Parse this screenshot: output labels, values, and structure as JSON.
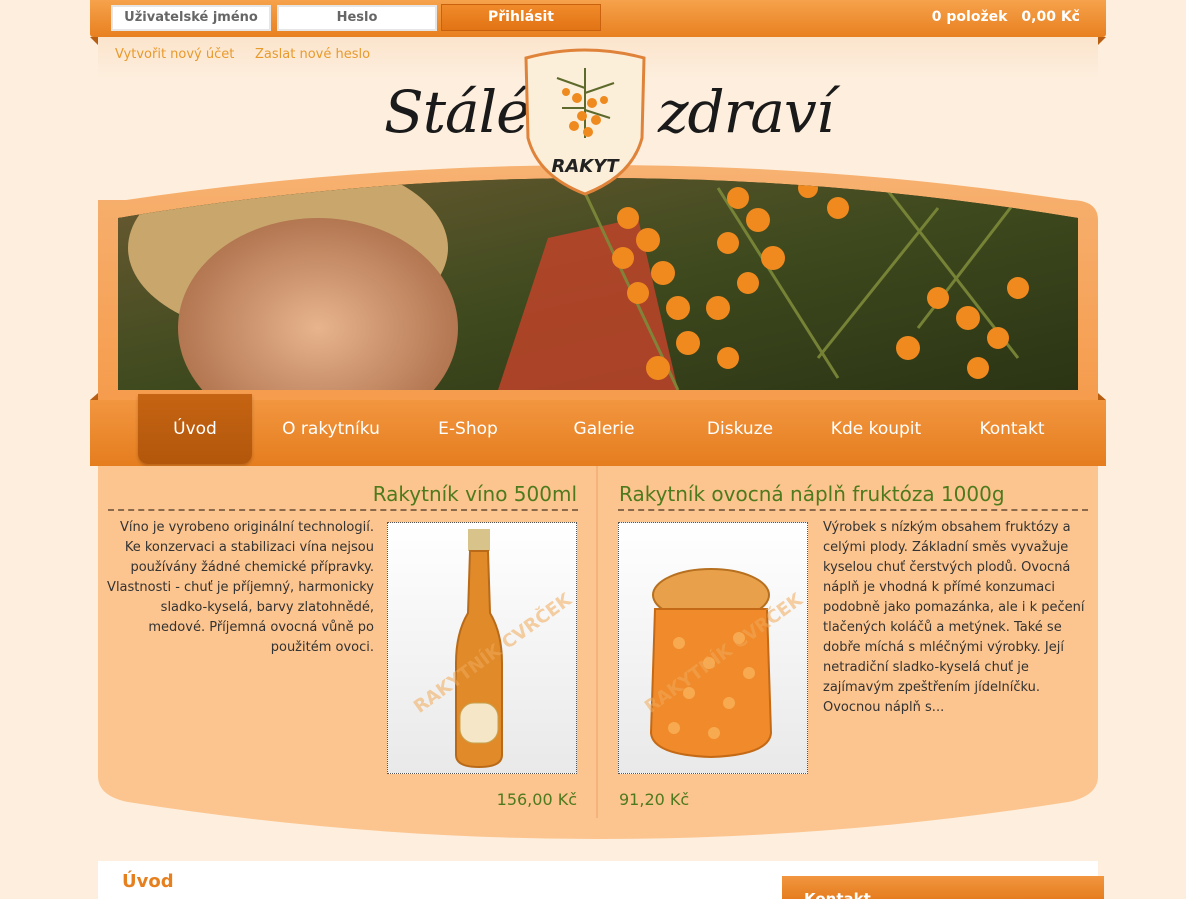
{
  "login": {
    "username_placeholder": "Uživatelské jméno",
    "password_placeholder": "Heslo",
    "submit_label": "Přihlásit"
  },
  "cart": {
    "items": "0 položek",
    "total": "0,00 Kč"
  },
  "account": {
    "create_label": "Vytvořit nový účet",
    "reset_label": "Zaslat nové heslo"
  },
  "logo": {
    "left": "Stálé",
    "right": "zdraví",
    "badge": "RAKYT"
  },
  "nav": {
    "items": [
      {
        "label": "Úvod",
        "active": true
      },
      {
        "label": "O rakytníku"
      },
      {
        "label": "E-Shop"
      },
      {
        "label": "Galerie"
      },
      {
        "label": "Diskuze"
      },
      {
        "label": "Kde koupit"
      },
      {
        "label": "Kontakt"
      }
    ]
  },
  "products": [
    {
      "title": "Rakytník víno 500ml",
      "description": "Víno je vyrobeno originální technologií. Ke konzervaci a stabilizaci vína nejsou používány žádné chemické přípravky. Vlastnosti - chuť je příjemný, harmonicky sladko-kyselá, barvy zlatohnědé, medové. Příjemná ovocná vůně po použitém ovoci.",
      "price": "156,00 Kč",
      "watermark": "RAKYTNÍK CVRČEK"
    },
    {
      "title": "Rakytník ovocná náplň fruktóza 1000g",
      "description": "Výrobek s nízkým obsahem fruktózy a celými plody. Základní směs vyvažuje kyselou chuť čerstvých plodů. Ovocná náplň je vhodná k přímé konzumaci podobně jako pomazánka, ale i k pečení tlačených koláčů a metýnek. Také se dobře míchá s mléčnými výrobky. Její netradiční sladko-kyselá chuť je zajímavým zpeštřením jídelníčku. Ovocnou náplň s...",
      "price": "91,20 Kč",
      "watermark": "RAKYTNÍK CVRČEK"
    }
  ],
  "content": {
    "section_title": "Úvod"
  },
  "sidebar": {
    "box_title": "Kontakt"
  },
  "colors": {
    "brand_orange": "#e8801f",
    "price_green": "#4e7a1e",
    "page_bg": "#fdeedd"
  }
}
